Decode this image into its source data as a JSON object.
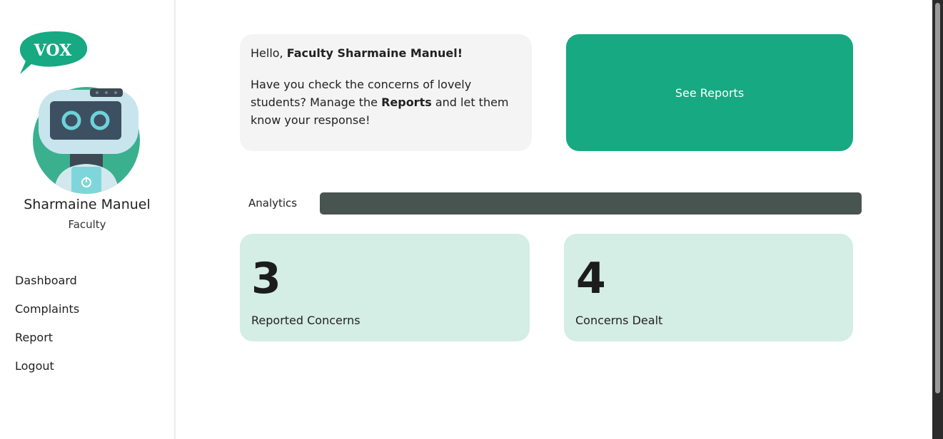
{
  "sidebar": {
    "logo_text": "VOX",
    "user_name": "Sharmaine Manuel",
    "user_role": "Faculty",
    "nav": [
      {
        "label": "Dashboard"
      },
      {
        "label": "Complaints"
      },
      {
        "label": "Report"
      },
      {
        "label": "Logout"
      }
    ]
  },
  "greeting": {
    "hello_prefix": "Hello, ",
    "hello_name": "Faculty Sharmaine Manuel!",
    "msg_part1": "Have you check the concerns of lovely students? Manage the ",
    "msg_bold": "Reports",
    "msg_part2": " and let them know your response!"
  },
  "actions": {
    "see_reports": "See Reports"
  },
  "analytics": {
    "label": "Analytics",
    "stats": [
      {
        "value": "3",
        "label": "Reported Concerns"
      },
      {
        "value": "4",
        "label": "Concerns Dealt"
      }
    ]
  },
  "colors": {
    "brand": "#16a982",
    "card_light": "#d4ede5",
    "bar_dark": "#485450"
  }
}
